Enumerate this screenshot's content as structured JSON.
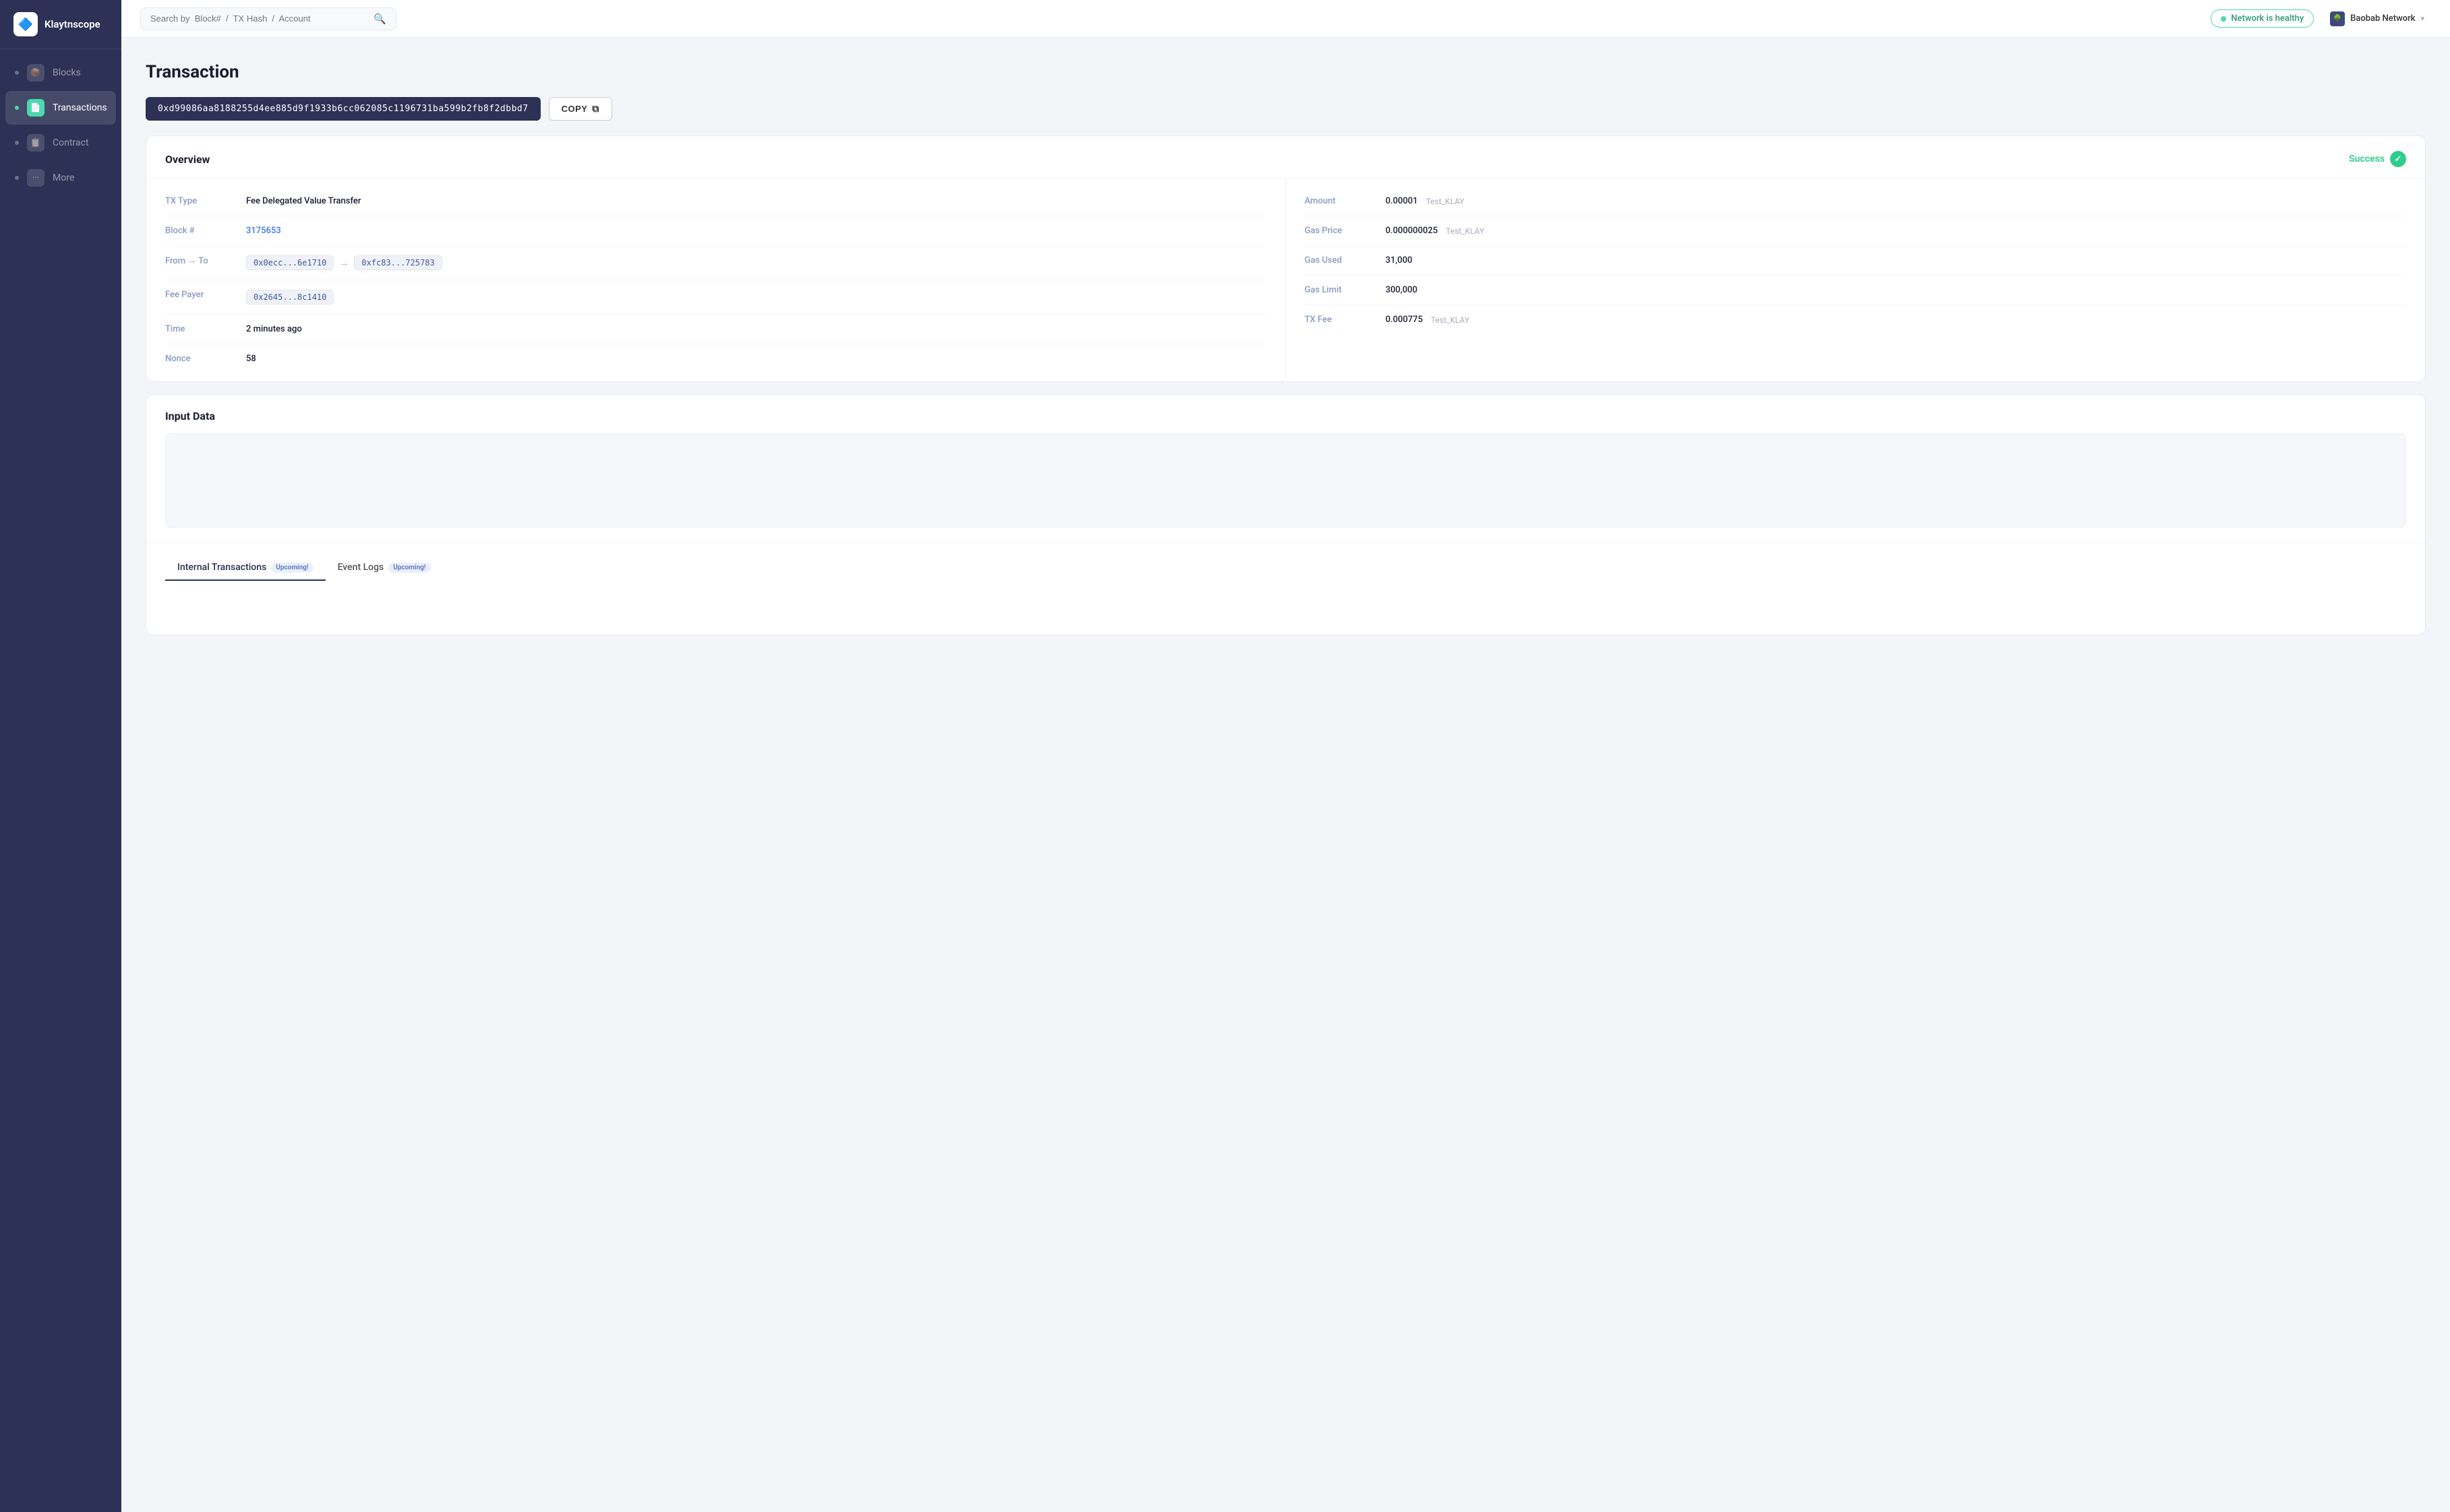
{
  "app": {
    "logo_text": "Klaytnscope",
    "logo_emoji": "🔷"
  },
  "sidebar": {
    "items": [
      {
        "id": "blocks",
        "label": "Blocks",
        "icon": "📦",
        "active": false
      },
      {
        "id": "transactions",
        "label": "Transactions",
        "icon": "📄",
        "active": true
      },
      {
        "id": "contract",
        "label": "Contract",
        "icon": "📋",
        "active": false
      },
      {
        "id": "more",
        "label": "More",
        "icon": "···",
        "active": false
      }
    ]
  },
  "header": {
    "search_placeholder": "Search by  Block#  /  TX Hash  /  Account",
    "network_status": "Network is healthy",
    "network_name": "Baobab Network"
  },
  "page": {
    "title": "Transaction",
    "tx_hash": "0xd99086aa8188255d4ee885d9f1933b6cc062085c1196731ba599b2fb8f2dbbd7",
    "copy_label": "COPY"
  },
  "overview": {
    "section_title": "Overview",
    "status": "Success",
    "fields_left": [
      {
        "label": "TX Type",
        "value": "Fee Delegated Value Transfer",
        "type": "text"
      },
      {
        "label": "Block #",
        "value": "3175653",
        "type": "link"
      },
      {
        "label": "From → To",
        "value": "",
        "type": "addresses",
        "from": "0x0ecc...6e1710",
        "to": "0xfc83...725783"
      },
      {
        "label": "Fee Payer",
        "value": "0x2645...8c1410",
        "type": "address"
      },
      {
        "label": "Time",
        "value": "2 minutes ago",
        "type": "text"
      },
      {
        "label": "Nonce",
        "value": "58",
        "type": "text"
      }
    ],
    "fields_right": [
      {
        "label": "Amount",
        "value": "0.00001",
        "unit": "Test_KLAY",
        "type": "amount"
      },
      {
        "label": "Gas Price",
        "value": "0.000000025",
        "unit": "Test_KLAY",
        "type": "amount"
      },
      {
        "label": "Gas Used",
        "value": "31,000",
        "type": "text"
      },
      {
        "label": "Gas Limit",
        "value": "300,000",
        "type": "text"
      },
      {
        "label": "TX Fee",
        "value": "0.000775",
        "unit": "Test_KLAY",
        "type": "amount"
      }
    ]
  },
  "input_data": {
    "section_title": "Input Data"
  },
  "tabs": [
    {
      "id": "internal-transactions",
      "label": "Internal Transactions",
      "upcoming": true,
      "active": true
    },
    {
      "id": "event-logs",
      "label": "Event Logs",
      "upcoming": true,
      "active": false
    }
  ],
  "upcoming_label": "Upcoming!"
}
